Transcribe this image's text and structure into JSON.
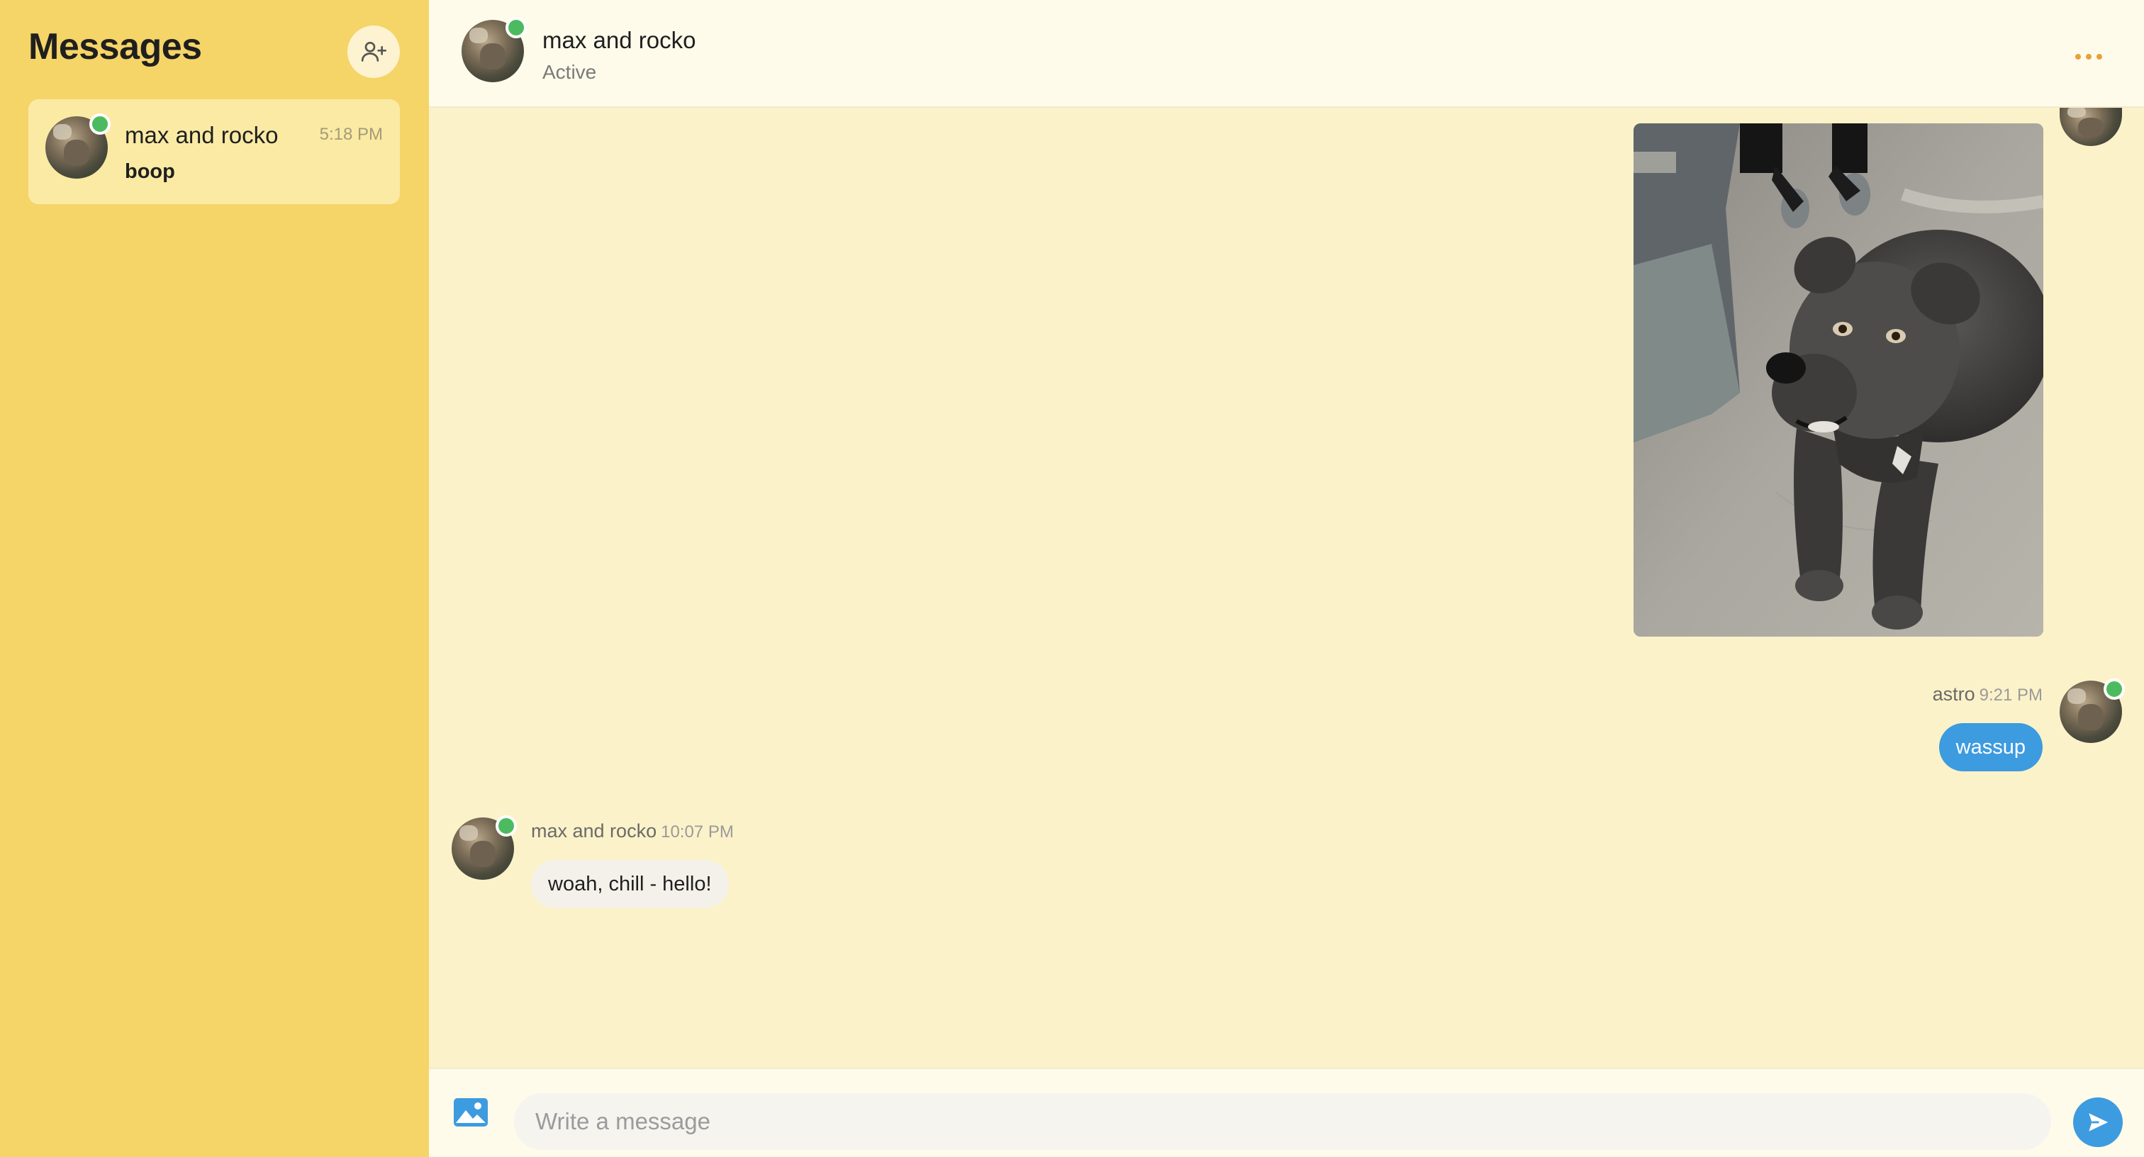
{
  "sidebar": {
    "title": "Messages",
    "new_chat_icon": "add-user-icon",
    "conversations": [
      {
        "name": "max and rocko",
        "time": "5:18 PM",
        "preview": "boop",
        "online": true
      }
    ]
  },
  "header": {
    "name": "max and rocko",
    "status": "Active",
    "more_icon": "more-horizontal-icon"
  },
  "messages": [
    {
      "type": "image",
      "direction": "outgoing",
      "description_icon": "dog-photo"
    },
    {
      "type": "text",
      "direction": "outgoing",
      "sender": "astro",
      "time": "9:21 PM",
      "text": "wassup"
    },
    {
      "type": "text",
      "direction": "incoming",
      "sender": "max and rocko",
      "time": "10:07 PM",
      "text": "woah, chill - hello!"
    }
  ],
  "composer": {
    "placeholder": "Write a message",
    "image_icon": "image-icon",
    "send_icon": "send-icon"
  },
  "colors": {
    "sidebar_bg": "#f5d468",
    "chat_bg": "#fcf2c9",
    "accent_blue": "#3d9be0",
    "online_green": "#4cbb5f",
    "menu_orange": "#e6a23c"
  }
}
